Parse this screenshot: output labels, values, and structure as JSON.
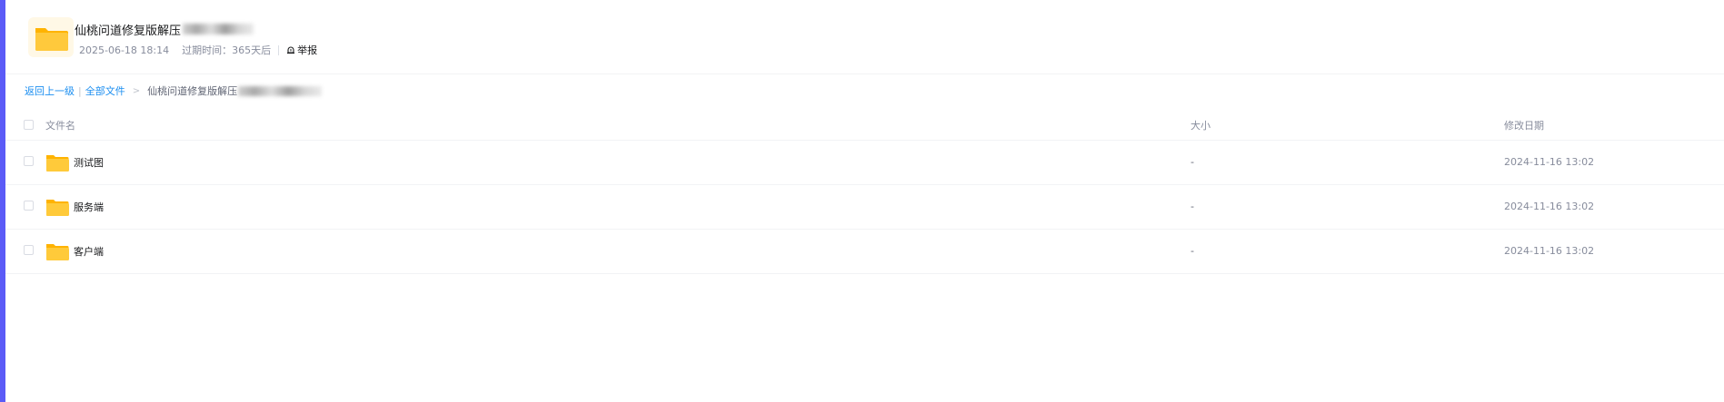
{
  "header": {
    "title": "仙桃问道修复版解压",
    "date": "2025-06-18 18:14",
    "expire_label": "过期时间：365天后",
    "report_label": "举报",
    "folder_icon": "folder-icon"
  },
  "breadcrumb": {
    "back": "返回上一级",
    "pipe": "|",
    "all_files": "全部文件",
    "arrow": ">",
    "current": "仙桃问道修复版解压"
  },
  "table": {
    "columns": {
      "name": "文件名",
      "size": "大小",
      "date": "修改日期"
    },
    "rows": [
      {
        "name": "测试图",
        "size": "-",
        "date": "2024-11-16 13:02"
      },
      {
        "name": "服务端",
        "size": "-",
        "date": "2024-11-16 13:02"
      },
      {
        "name": "客户端",
        "size": "-",
        "date": "2024-11-16 13:02"
      }
    ]
  },
  "colors": {
    "accent": "#5b5bf7",
    "link": "#1b8ef0",
    "folder": "#ffc53d"
  }
}
